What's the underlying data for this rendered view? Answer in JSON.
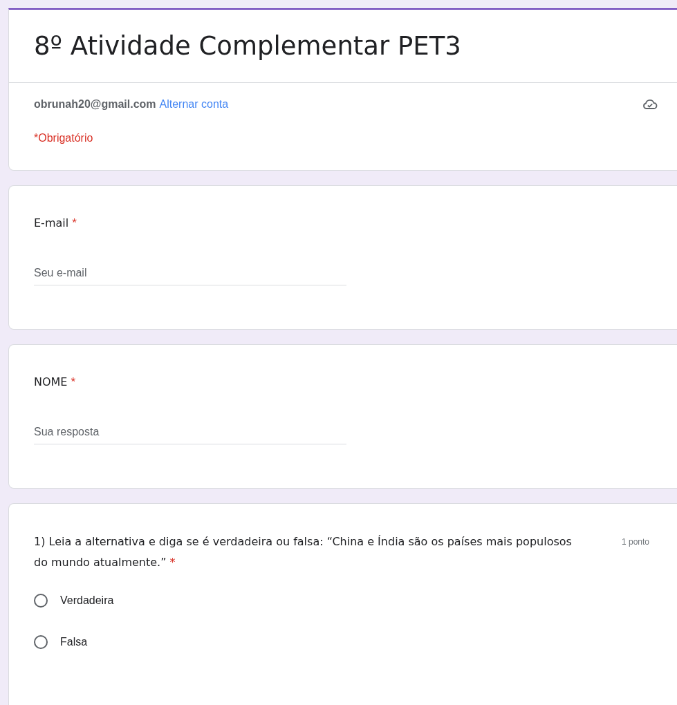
{
  "form": {
    "title": "8º Atividade Complementar PET3",
    "account_email": "obrunah20@gmail.com",
    "switch_account": "Alternar conta",
    "required_note": "*Obrigatório"
  },
  "questions": [
    {
      "kind": "text",
      "label": "E-mail",
      "required_mark": "*",
      "placeholder": "Seu e-mail"
    },
    {
      "kind": "text",
      "label": "NOME",
      "required_mark": "*",
      "placeholder": "Sua resposta"
    },
    {
      "kind": "radio",
      "label": "1) Leia a alternativa e diga se é verdadeira ou falsa: “China e Índia são os países mais populosos do mundo atualmente.”",
      "required_mark": "*",
      "points": "1 ponto",
      "options": [
        {
          "label": "Verdadeira",
          "selected": false
        },
        {
          "label": "Falsa",
          "selected": false
        }
      ]
    }
  ]
}
